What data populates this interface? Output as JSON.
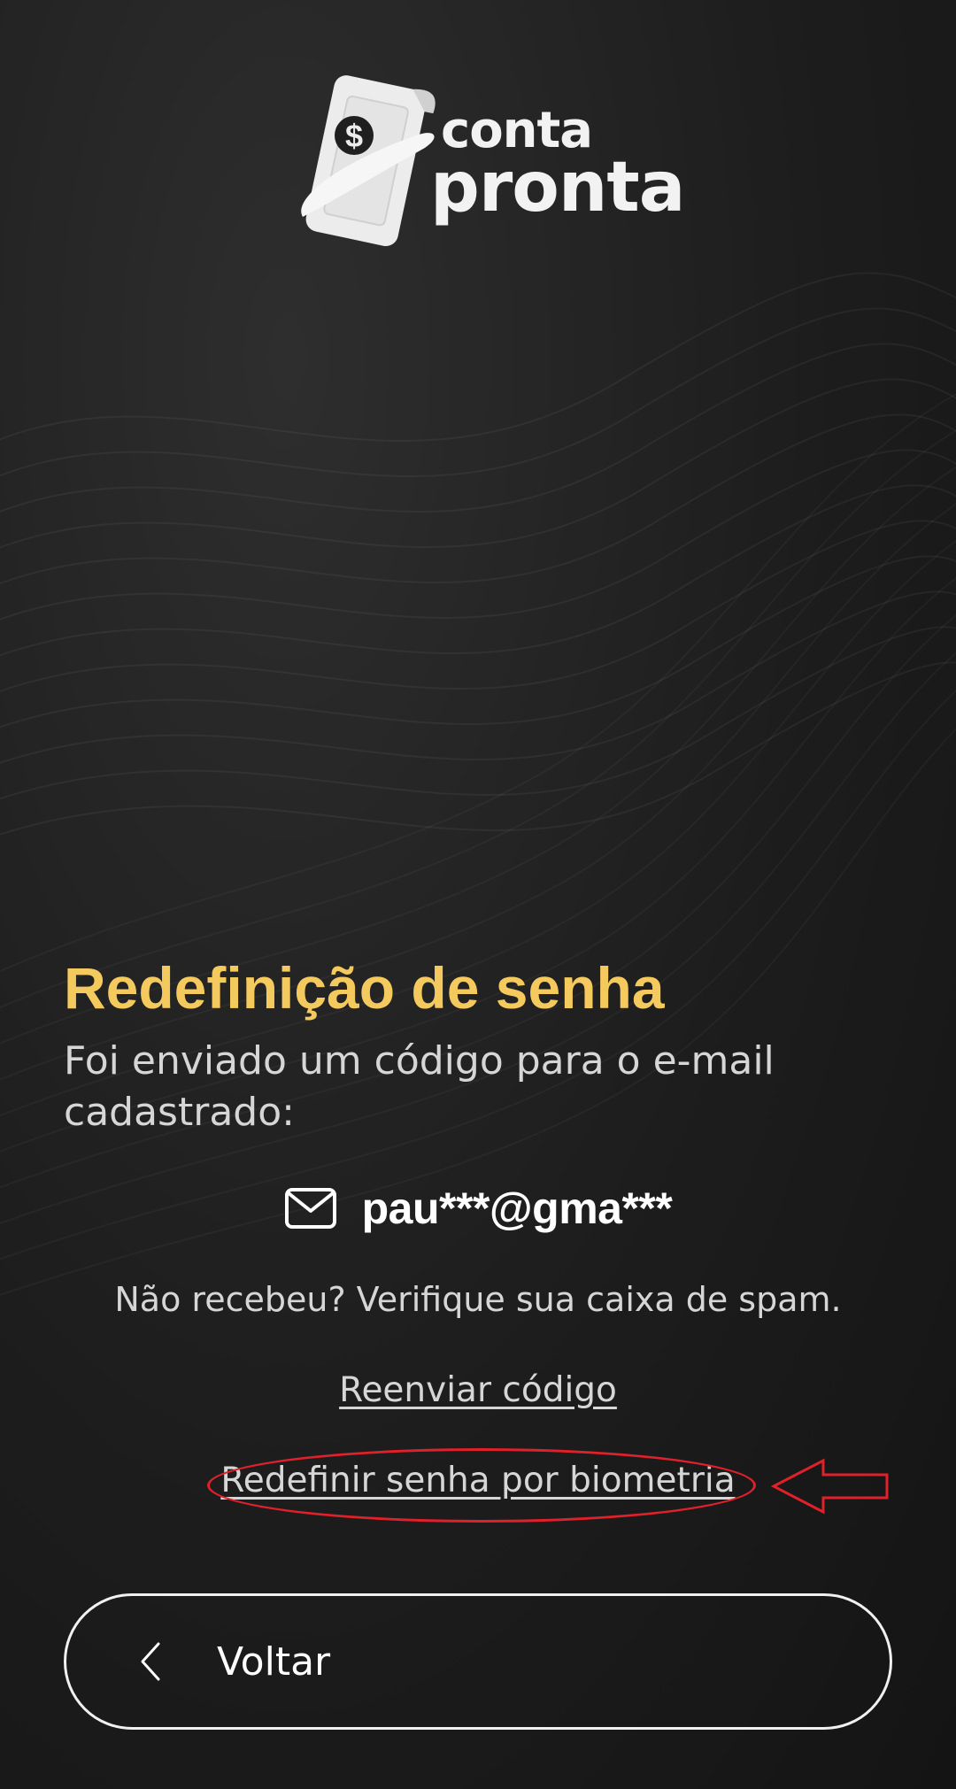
{
  "brand": {
    "logo_line1": "conta",
    "logo_line2": "pronta",
    "logo_symbol": "$"
  },
  "reset": {
    "title": "Redefinição de senha",
    "subtitle": "Foi enviado um código para o e-mail cadastrado:",
    "email_icon": "envelope-icon",
    "email_masked": "pau***@gma***",
    "spam_note": "Não recebeu? Verifique sua caixa de spam.",
    "resend_label": "Reenviar código",
    "biometric_label": "Redefinir senha por biometria"
  },
  "back": {
    "icon": "chevron-left-icon",
    "label": "Voltar"
  },
  "annotation": {
    "color": "#e0202a",
    "shape": "oval-with-left-arrow"
  },
  "colors": {
    "title": "#f4c95d",
    "text": "#d6d6d6",
    "background": "#1d1d1d"
  }
}
